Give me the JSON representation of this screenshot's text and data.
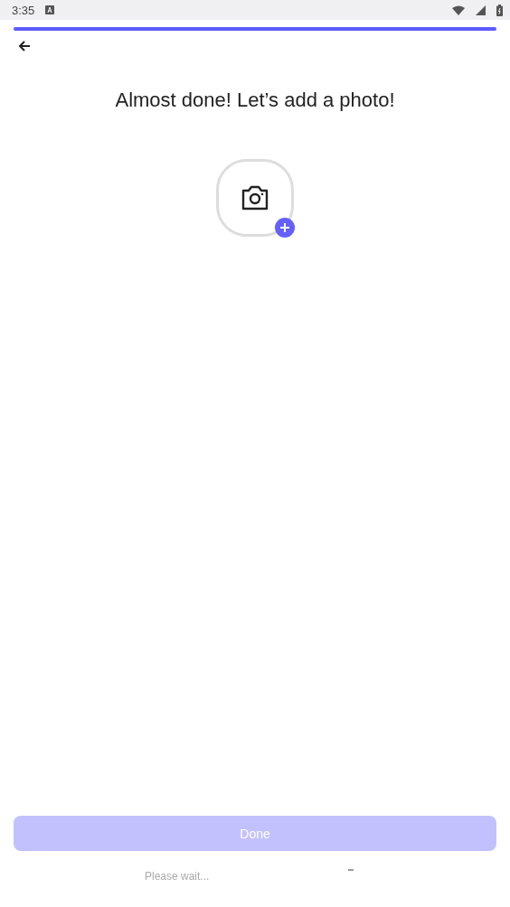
{
  "status_bar": {
    "time": "3:35"
  },
  "progress": {
    "level": 1
  },
  "title": "Almost done! Let’s add a photo!",
  "done_button": {
    "label": "Done",
    "disabled": true
  },
  "footer_text": "Please wait..."
}
